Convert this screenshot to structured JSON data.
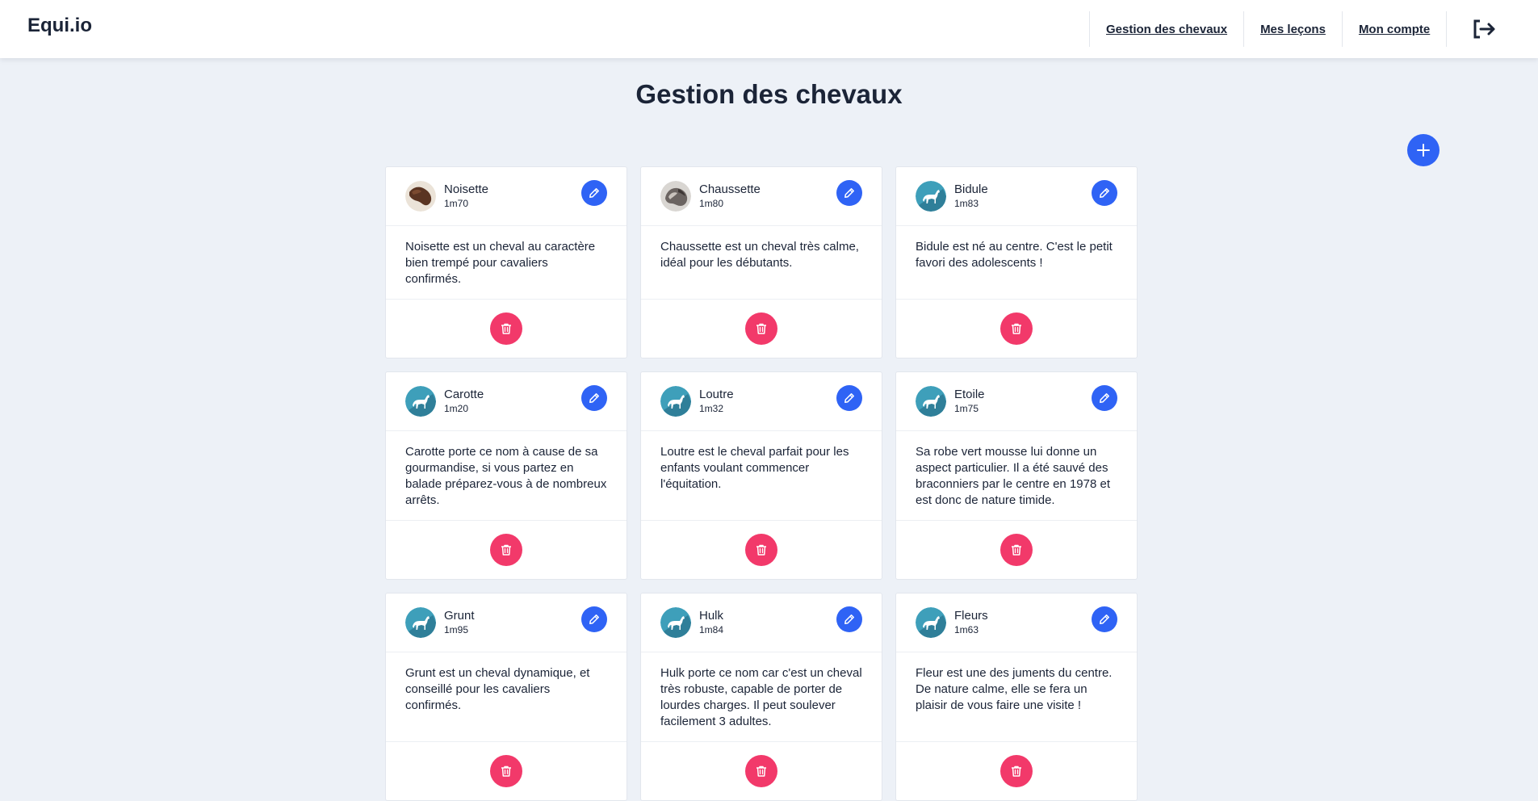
{
  "brand": "Equi.io",
  "nav": {
    "items": [
      {
        "label": "Gestion des chevaux"
      },
      {
        "label": "Mes leçons"
      },
      {
        "label": "Mon compte"
      }
    ],
    "logout_icon": "logout-icon"
  },
  "page": {
    "title": "Gestion des chevaux",
    "add_icon": "plus-icon"
  },
  "colors": {
    "primary": "#2f63f5",
    "danger": "#f2396a",
    "background": "#edf1f7",
    "text": "#1b2437"
  },
  "horses": [
    {
      "name": "Noisette",
      "height": "1m70",
      "description": "Noisette est un cheval au caractère bien trempé pour cavaliers confirmés.",
      "avatar": "photo-brown"
    },
    {
      "name": "Chaussette",
      "height": "1m80",
      "description": "Chaussette est un cheval très calme, idéal pour les débutants.",
      "avatar": "photo-grey"
    },
    {
      "name": "Bidule",
      "height": "1m83",
      "description": "Bidule est né au centre. C'est le petit favori des adolescents !",
      "avatar": "horse-icon"
    },
    {
      "name": "Carotte",
      "height": "1m20",
      "description": "Carotte porte ce nom à cause de sa gourmandise, si vous partez en balade préparez-vous à de nombreux arrêts.",
      "avatar": "horse-icon"
    },
    {
      "name": "Loutre",
      "height": "1m32",
      "description": "Loutre est le cheval parfait pour les enfants voulant commencer l'équitation.",
      "avatar": "horse-icon"
    },
    {
      "name": "Etoile",
      "height": "1m75",
      "description": "Sa robe vert mousse lui donne un aspect particulier. Il a été sauvé des braconniers par le centre en 1978 et est donc de nature timide.",
      "avatar": "horse-icon"
    },
    {
      "name": "Grunt",
      "height": "1m95",
      "description": "Grunt est un cheval dynamique, et conseillé pour les cavaliers confirmés.",
      "avatar": "horse-icon"
    },
    {
      "name": "Hulk",
      "height": "1m84",
      "description": "Hulk porte ce nom car c'est un cheval très robuste, capable de porter de lourdes charges. Il peut soulever facilement 3 adultes.",
      "avatar": "horse-icon"
    },
    {
      "name": "Fleurs",
      "height": "1m63",
      "description": "Fleur est une des juments du centre. De nature calme, elle se fera un plaisir de vous faire une visite !",
      "avatar": "horse-icon"
    }
  ]
}
